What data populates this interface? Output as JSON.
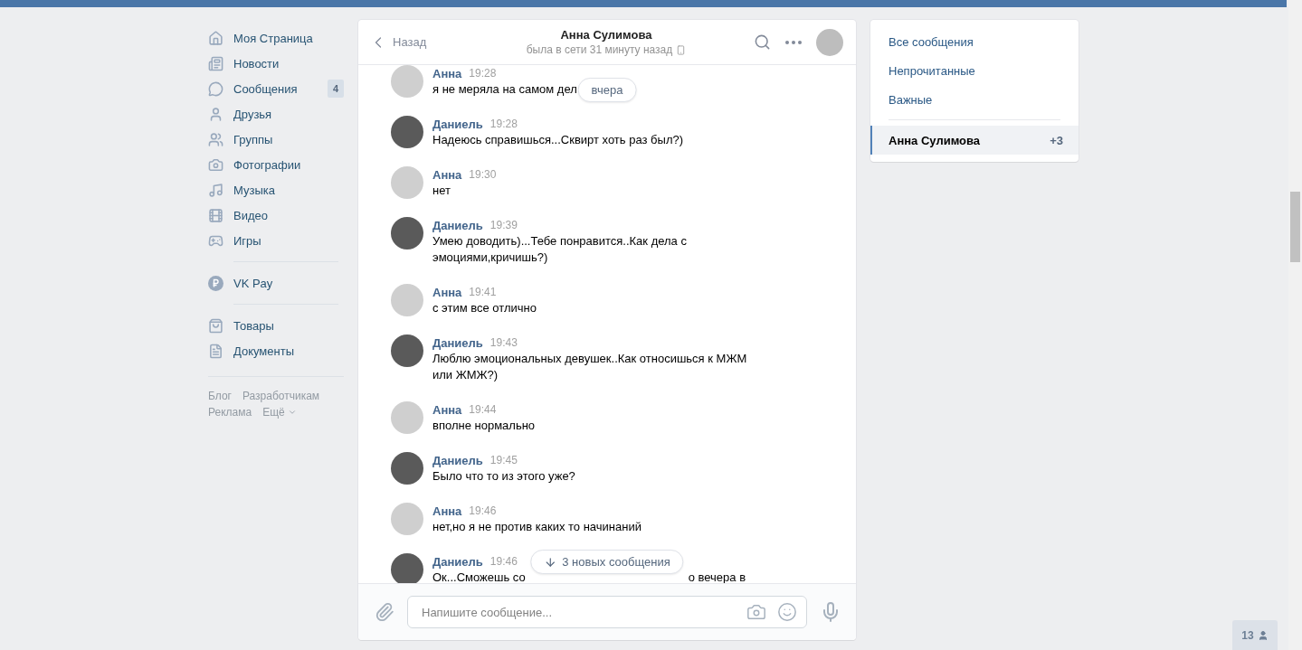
{
  "sidebar": {
    "groups": [
      {
        "items": [
          {
            "label": "Моя Страница"
          },
          {
            "label": "Новости"
          },
          {
            "label": "Сообщения",
            "count": "4"
          },
          {
            "label": "Друзья"
          },
          {
            "label": "Группы"
          },
          {
            "label": "Фотографии"
          },
          {
            "label": "Музыка"
          },
          {
            "label": "Видео"
          },
          {
            "label": "Игры"
          }
        ]
      },
      {
        "items": [
          {
            "label": "VK Pay"
          }
        ]
      },
      {
        "items": [
          {
            "label": "Товары"
          },
          {
            "label": "Документы"
          }
        ]
      }
    ],
    "footer_links": [
      "Блог",
      "Разработчикам",
      "Реклама",
      "Ещё"
    ]
  },
  "chat": {
    "back": "Назад",
    "title": "Анна Сулимова",
    "status": "была в сети 31 минуту назад",
    "date_pill": "вчера",
    "new_messages_pill": "3 новых сообщения",
    "messages": [
      {
        "kind": "peer",
        "author": "Анна",
        "time": "19:28",
        "fragments": [
          "я не меряла на самом дел"
        ]
      },
      {
        "kind": "self",
        "author": "Даниель",
        "time": "19:28",
        "fragments": [
          "Надеюсь справишься...Сквирт хоть раз был?)"
        ]
      },
      {
        "kind": "peer",
        "author": "Анна",
        "time": "19:30",
        "fragments": [
          "нет"
        ]
      },
      {
        "kind": "self",
        "author": "Даниель",
        "time": "19:39",
        "fragments": [
          "Умею доводить)...Тебе понравится..Как дела с эмоциями,кричишь?)"
        ]
      },
      {
        "kind": "peer",
        "author": "Анна",
        "time": "19:41",
        "fragments": [
          "с этим все отлично"
        ]
      },
      {
        "kind": "self",
        "author": "Даниель",
        "time": "19:43",
        "fragments": [
          "Люблю эмоциональных девушек..Как относишься к МЖМ или ЖМЖ?)"
        ]
      },
      {
        "kind": "peer",
        "author": "Анна",
        "time": "19:44",
        "fragments": [
          "вполне нормально"
        ]
      },
      {
        "kind": "self",
        "author": "Даниель",
        "time": "19:45",
        "fragments": [
          "Было что то из этого уже?"
        ]
      },
      {
        "kind": "peer",
        "author": "Анна",
        "time": "19:46",
        "fragments": [
          "нет,но я не против каких то начинаний"
        ]
      },
      {
        "kind": "self",
        "author": "Даниель",
        "time": "19:46",
        "fragments": [
          "Ок...Сможешь со",
          "о вечера в"
        ]
      }
    ],
    "composer": {
      "placeholder": "Напишите сообщение..."
    }
  },
  "filters": {
    "items": [
      {
        "label": "Все сообщения"
      },
      {
        "label": "Непрочитанные"
      },
      {
        "label": "Важные"
      }
    ],
    "conversations": [
      {
        "name": "Анна Сулимова",
        "count": "+3",
        "selected": true
      }
    ]
  },
  "online_badge": "13"
}
